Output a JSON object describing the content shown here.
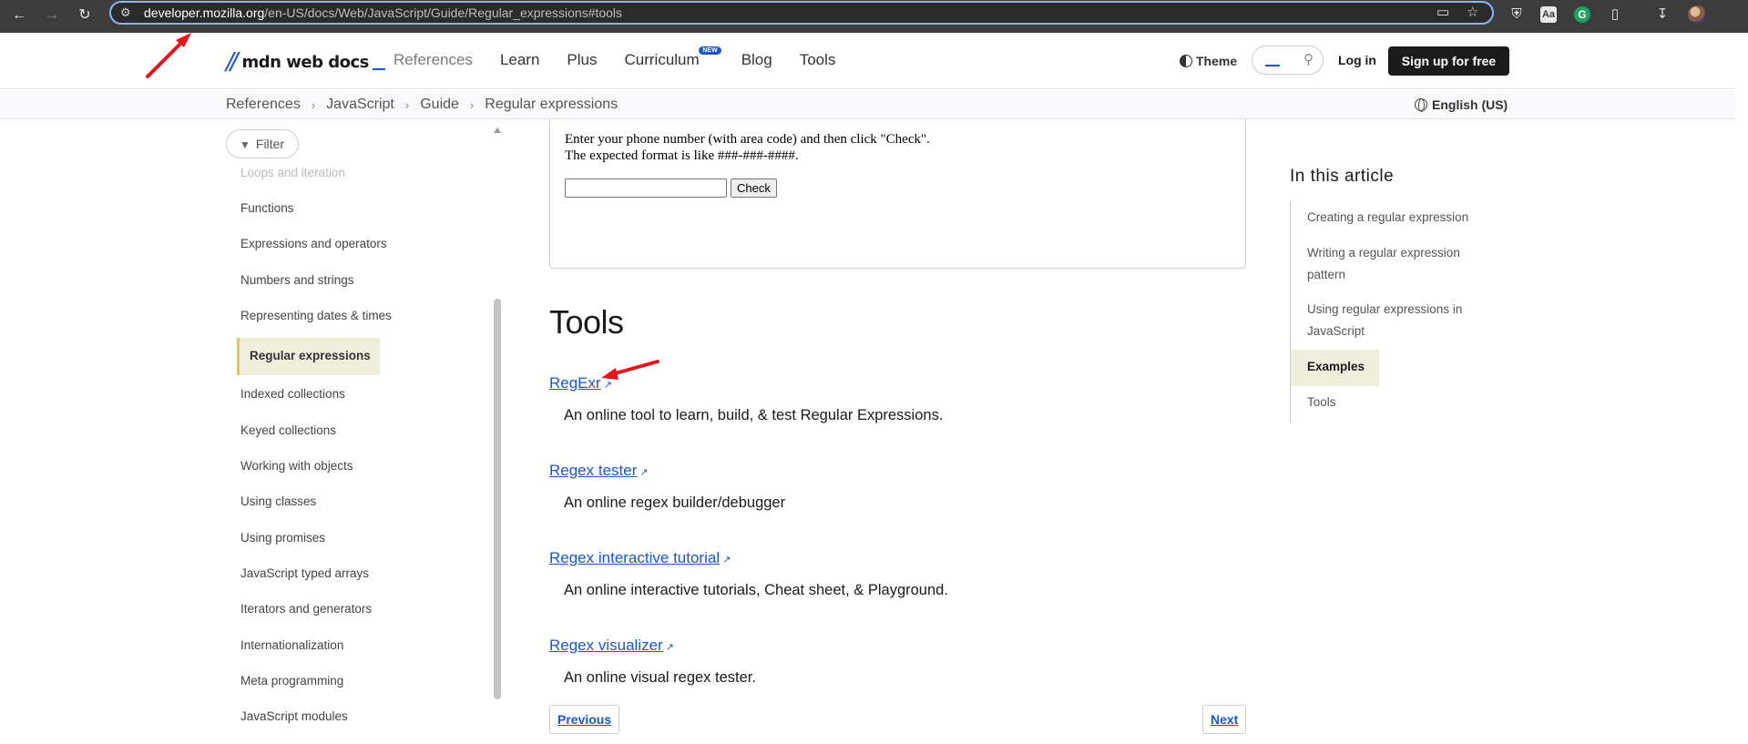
{
  "browser": {
    "url_host": "developer.mozilla.org",
    "url_path": "/en-US/docs/Web/JavaScript/Guide/Regular_expressions#tools",
    "icons": [
      "back-icon",
      "forward-icon",
      "reload-icon",
      "site-info-icon",
      "install-icon",
      "bookmark-star-icon",
      "shield-extension-icon",
      "dictionary-extension-icon",
      "grammarly-extension-icon",
      "extensions-puzzle-icon",
      "download-icon",
      "profile-avatar-icon"
    ],
    "ext_aa": "Aa",
    "ext_g": "G"
  },
  "header": {
    "logo_text": "mdn web docs",
    "nav": [
      "References",
      "Learn",
      "Plus",
      "Curriculum",
      "Blog",
      "Tools"
    ],
    "new_badge": "NEW",
    "theme_label": "Theme",
    "login_label": "Log in",
    "signup_label": "Sign up for free"
  },
  "breadcrumb": {
    "items": [
      "References",
      "JavaScript",
      "Guide",
      "Regular expressions"
    ],
    "language": "English (US)"
  },
  "sidebar": {
    "filter_label": "Filter",
    "items": [
      "Loops and iteration",
      "Functions",
      "Expressions and operators",
      "Numbers and strings",
      "Representing dates & times",
      "Regular expressions",
      "Indexed collections",
      "Keyed collections",
      "Working with objects",
      "Using classes",
      "Using promises",
      "JavaScript typed arrays",
      "Iterators and generators",
      "Internationalization",
      "Meta programming",
      "JavaScript modules"
    ],
    "active_item": "Regular expressions"
  },
  "demo": {
    "line1": "Enter your phone number (with area code) and then click \"Check\".",
    "line2": "The expected format is like ###-###-####.",
    "input_value": "",
    "check_label": "Check"
  },
  "main": {
    "heading": "Tools",
    "tools": [
      {
        "name": "RegExr",
        "description": "An online tool to learn, build, & test Regular Expressions."
      },
      {
        "name": "Regex tester",
        "description": "An online regex builder/debugger"
      },
      {
        "name": "Regex interactive tutorial",
        "description": "An online interactive tutorials, Cheat sheet, & Playground."
      },
      {
        "name": "Regex visualizer",
        "description": "An online visual regex tester."
      }
    ],
    "previous_label": "Previous",
    "next_label": "Next"
  },
  "toc": {
    "title": "In this article",
    "items": [
      "Creating a regular expression",
      "Writing a regular expression pattern",
      "Using regular expressions in JavaScript",
      "Examples",
      "Tools"
    ],
    "active_item": "Examples"
  },
  "colors": {
    "accent_link": "#1a57c7",
    "active_highlight": "#efeedd",
    "annotation_arrow": "#e8141c",
    "chrome_bg": "#3c3c3c"
  }
}
